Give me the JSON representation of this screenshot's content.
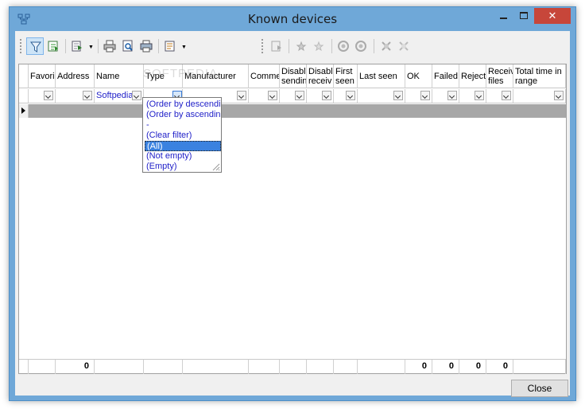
{
  "window": {
    "title": "Known devices",
    "close_glyph": "✕"
  },
  "toolbar": {
    "icons": [
      "filter-icon",
      "export-icon",
      "export-dropdown-icon",
      "print-icon",
      "print-preview-icon",
      "printer-icon",
      "columns-icon",
      "import-icon",
      "favorite-icon",
      "unfavorite-icon",
      "ping-icon",
      "ping-all-icon",
      "disable-icon",
      "enable-icon"
    ]
  },
  "grid": {
    "columns": [
      {
        "key": "favorite",
        "label": "Favori"
      },
      {
        "key": "address",
        "label": "Address"
      },
      {
        "key": "name",
        "label": "Name"
      },
      {
        "key": "type",
        "label": "Type"
      },
      {
        "key": "manufacturer",
        "label": "Manufacturer"
      },
      {
        "key": "comment",
        "label": "Comme"
      },
      {
        "key": "disable_sending",
        "label": "Disable sendin"
      },
      {
        "key": "disable_receiving",
        "label": "Disable receiv"
      },
      {
        "key": "first_seen",
        "label": "First seen"
      },
      {
        "key": "last_seen",
        "label": "Last seen"
      },
      {
        "key": "ok",
        "label": "OK"
      },
      {
        "key": "failed",
        "label": "Failed"
      },
      {
        "key": "rejected",
        "label": "Reject"
      },
      {
        "key": "received_files",
        "label": "Receiv files"
      },
      {
        "key": "total_time",
        "label": "Total time in range"
      }
    ],
    "filter_name_value": "Softpedia",
    "totals": {
      "address": "0",
      "ok": "0",
      "failed": "0",
      "rejected": "0",
      "received_files": "0"
    }
  },
  "filter_dropdown": {
    "items": [
      "(Order by descending)",
      "(Order by ascending)",
      "-",
      "(Clear filter)",
      "(All)",
      "(Not empty)",
      "(Empty)"
    ],
    "selected_index": 4
  },
  "watermark": "SOFTPEDIA",
  "buttons": {
    "close_label": "Close"
  }
}
